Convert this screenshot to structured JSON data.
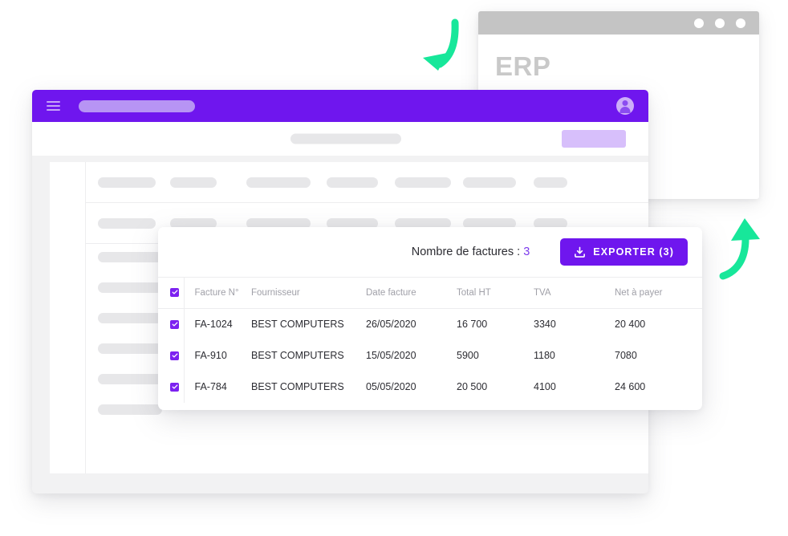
{
  "erp_window": {
    "title": "ERP",
    "traffic_dots": 3,
    "titlebar_color": "#c4c4c4"
  },
  "app_window": {
    "header": {
      "menu_icon": "hamburger-icon",
      "avatar_icon": "user-avatar-icon",
      "accent_color": "#6F16EE"
    },
    "subbar": {
      "button_color": "#d7bffb"
    },
    "skeleton": {
      "row_count": 2,
      "columns_per_row": 7,
      "pill_widths": [
        72,
        58,
        80,
        64,
        70,
        66,
        42
      ],
      "left_column_placeholder_count": 6,
      "pill_color": "#e7e7e9"
    }
  },
  "invoice_card": {
    "count_label": "Nombre de factures :",
    "count_value": "3",
    "export_label": "EXPORTER (3)",
    "export_icon": "download-icon",
    "header_checkbox_checked": true,
    "columns": [
      "Facture N°",
      "Fournisseur",
      "Date facture",
      "Total HT",
      "TVA",
      "Net à payer"
    ],
    "rows": [
      {
        "checked": true,
        "facture_no": "FA-1024",
        "fournisseur": "BEST COMPUTERS",
        "date_facture": "26/05/2020",
        "total_ht": "16 700",
        "tva": "3340",
        "net_a_payer": "20 400"
      },
      {
        "checked": true,
        "facture_no": "FA-910",
        "fournisseur": "BEST COMPUTERS",
        "date_facture": "15/05/2020",
        "total_ht": "5900",
        "tva": "1180",
        "net_a_payer": "7080"
      },
      {
        "checked": true,
        "facture_no": "FA-784",
        "fournisseur": "BEST COMPUTERS",
        "date_facture": "05/05/2020",
        "total_ht": "20 500",
        "tva": "4100",
        "net_a_payer": "24 600"
      }
    ],
    "accent_color": "#7C21F0"
  },
  "arrows": {
    "color": "#17E79A",
    "down_arrow_icon": "curved-arrow-down-icon",
    "up_arrow_icon": "curved-arrow-up-icon"
  }
}
